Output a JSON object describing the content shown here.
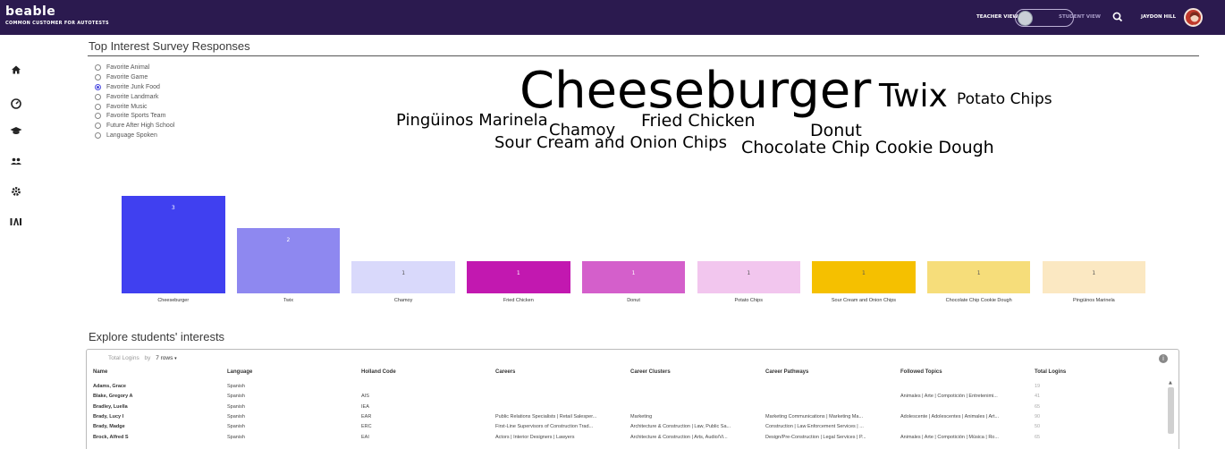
{
  "header": {
    "logo": "beable",
    "subtitle": "COMMON CUSTOMER FOR AUTOTESTS",
    "teacher_view": "TEACHER VIEW",
    "student_view": "STUDENT VIEW",
    "user_name": "JAYDON HILL"
  },
  "sidebar": {
    "items": [
      {
        "icon": "home-icon"
      },
      {
        "icon": "dashboard-icon"
      },
      {
        "icon": "graduation-cap-icon"
      },
      {
        "icon": "people-icon"
      },
      {
        "icon": "gear-icon"
      },
      {
        "icon": "ai-icon"
      }
    ]
  },
  "survey": {
    "title": "Top Interest Survey Responses",
    "options": [
      {
        "label": "Favorite Animal",
        "selected": false
      },
      {
        "label": "Favorite Game",
        "selected": false
      },
      {
        "label": "Favorite Junk Food",
        "selected": true
      },
      {
        "label": "Favorite Landmark",
        "selected": false
      },
      {
        "label": "Favorite Music",
        "selected": false
      },
      {
        "label": "Favorite Sports Team",
        "selected": false
      },
      {
        "label": "Future After High School",
        "selected": false
      },
      {
        "label": "Language Spoken",
        "selected": false
      }
    ]
  },
  "word_cloud": [
    {
      "text": "Cheeseburger",
      "color": "#4040f0"
    },
    {
      "text": "Twix",
      "color": "#8e88f0"
    },
    {
      "text": "Potato Chips",
      "color": "#f2c6ee"
    },
    {
      "text": "Pingüinos Marinela",
      "color": "#fbe8c2"
    },
    {
      "text": "Chamoy",
      "color": "#d9d9fb"
    },
    {
      "text": "Fried Chicken",
      "color": "#c218b0"
    },
    {
      "text": "Donut",
      "color": "#d45fcb"
    },
    {
      "text": "Sour Cream and Onion Chips",
      "color": "#f5c000"
    },
    {
      "text": "Chocolate Chip Cookie Dough",
      "color": "#f6dd7a"
    }
  ],
  "chart_data": {
    "type": "bar",
    "categories": [
      "Cheeseburger",
      "Twix",
      "Chamoy",
      "Fried Chicken",
      "Donut",
      "Potato Chips",
      "Sour Cream and Onion Chips",
      "Chocolate Chip Cookie Dough",
      "Pingüinos Marinela"
    ],
    "values": [
      3,
      2,
      1,
      1,
      1,
      1,
      1,
      1,
      1
    ],
    "colors": [
      "#4040f0",
      "#8e88f0",
      "#d9d9fb",
      "#c218b0",
      "#d45fcb",
      "#f2c6ee",
      "#f5c000",
      "#f6dd7a",
      "#fbe8c2"
    ],
    "ylim": [
      0,
      3
    ]
  },
  "explore": {
    "title": "Explore students' interests",
    "total_logins": "Total Logins",
    "by": "by",
    "rows_select": "7 rows",
    "columns": [
      "Name",
      "Language",
      "Holland Code",
      "Careers",
      "Career Clusters",
      "Career Pathways",
      "Followed Topics",
      "Total Logins"
    ],
    "rows": [
      [
        "Adams, Grace",
        "Spanish",
        "",
        "",
        "",
        "",
        "",
        "19"
      ],
      [
        "Blake, Gregory A",
        "Spanish",
        "AIS",
        "",
        "",
        "",
        "Animales | Arte | Compotición | Entretenimi...",
        "41"
      ],
      [
        "Bradley, Luella",
        "Spanish",
        "IEA",
        "",
        "",
        "",
        "",
        "65"
      ],
      [
        "Brady, Lucy I",
        "Spanish",
        "EAR",
        "Public Relations Specialists | Retail Salesper...",
        "Marketing",
        "Marketing Communications | Marketing Ma...",
        "Adolescente | Adolescentes | Animales | Art...",
        "90"
      ],
      [
        "Brady, Madge",
        "Spanish",
        "ERC",
        "First-Line Supervisors of Construction Trad...",
        "Architecture & Construction | Law, Public Sa...",
        "Construction | Law Enforcement Services | ...",
        "",
        "50"
      ],
      [
        "Brock, Alfred S",
        "Spanish",
        "EAI",
        "Actors | Interior Designers | Lawyers",
        "Architecture & Construction | Arts, Audio/Vi...",
        "Design/Pre-Construction | Legal Services | P...",
        "Animales | Arte | Compotición | Música | Ro...",
        "65"
      ]
    ]
  }
}
